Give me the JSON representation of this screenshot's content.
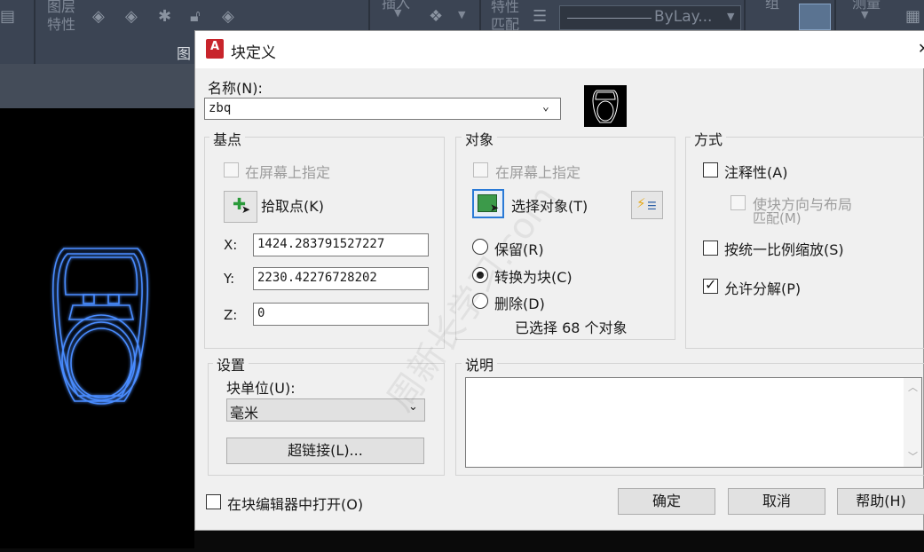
{
  "ribbon": {
    "layer_props_label_1": "图层",
    "layer_props_label_2": "特性",
    "insert_label": "插入",
    "match_props_label_1": "特性",
    "match_props_label_2": "匹配",
    "bylayer_value": "ByLay...",
    "group_label": "组",
    "measure_label": "测量",
    "tab_partial": "图"
  },
  "dialog": {
    "title": "块定义",
    "name_label": "名称(N):",
    "name_value": "zbq",
    "close_glyph": "✕",
    "basepoint": {
      "title": "基点",
      "specify_on_screen": "在屏幕上指定",
      "pick_point": "拾取点(K)",
      "x_label": "X:",
      "y_label": "Y:",
      "z_label": "Z:",
      "x_value": "1424.283791527227",
      "y_value": "2230.42276728202",
      "z_value": "0"
    },
    "objects": {
      "title": "对象",
      "specify_on_screen": "在屏幕上指定",
      "select_objects": "选择对象(T)",
      "retain": "保留(R)",
      "convert_to_block": "转换为块(C)",
      "delete": "删除(D)",
      "selected_status": "已选择 68 个对象"
    },
    "behavior": {
      "title": "方式",
      "annotative": "注释性(A)",
      "match_orientation_1": "使块方向与布局",
      "match_orientation_2": "匹配(M)",
      "scale_uniformly": "按统一比例缩放(S)",
      "allow_exploding": "允许分解(P)",
      "allow_exploding_checked": true,
      "convert_checked": true
    },
    "settings": {
      "title": "设置",
      "block_unit_label": "块单位(U):",
      "block_unit_value": "毫米",
      "hyperlink_button": "超链接(L)..."
    },
    "description": {
      "title": "说明"
    },
    "open_in_editor": "在块编辑器中打开(O)",
    "ok_button": "确定",
    "cancel_button": "取消",
    "help_button": "帮助(H)"
  },
  "watermark": "周新长学习.com",
  "colors": {
    "accent_blue": "#2a7ad6",
    "autocad_red": "#c8242b",
    "neon_outline": "#4a8cff"
  }
}
